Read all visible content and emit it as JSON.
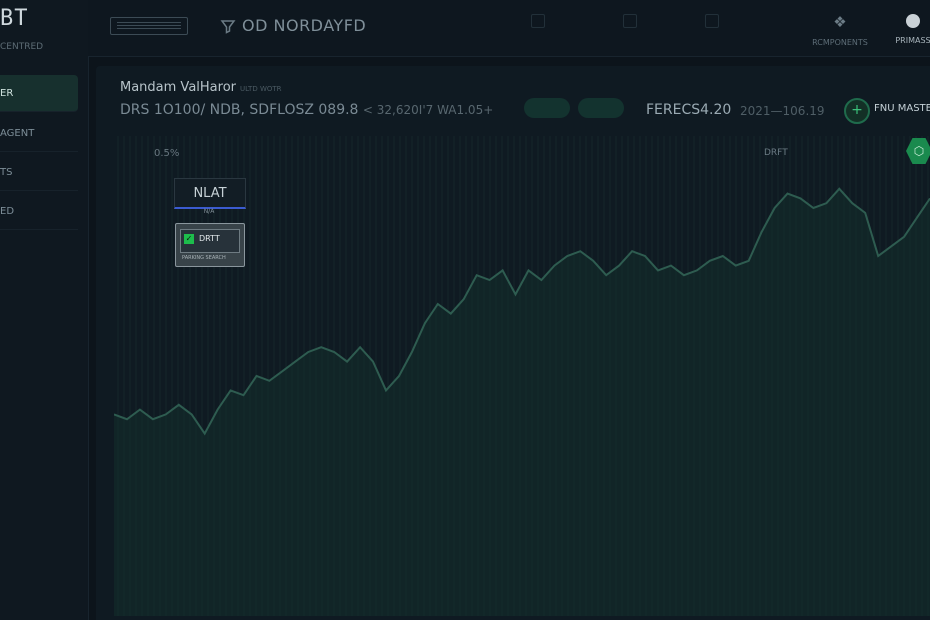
{
  "app": {
    "logo": "BT",
    "logo_sub": "CENTRED",
    "title": "OD NORDAYFD"
  },
  "icons": {
    "menu": "menu-icon",
    "filter": "filter-icon",
    "components": "network-icon",
    "avatar": "user-avatar-icon",
    "add": "plus-icon",
    "hex": "hexagon-icon",
    "check": "check-icon"
  },
  "colors": {
    "accent": "#1a8a4e",
    "chart_line": "#2e5c50",
    "selection": "#3b5bd1"
  },
  "sidebar": {
    "items": [
      {
        "label": "ER",
        "active": true
      },
      {
        "label": "AGENT",
        "active": false
      },
      {
        "label": "TS",
        "active": false
      },
      {
        "label": "ED",
        "active": false
      }
    ]
  },
  "topnav": {
    "components_label": "RCMPONENTS",
    "user_label": "PRIMASS"
  },
  "panel": {
    "title": "Mandam ValHaror",
    "subtitle": "ULTD WOTR",
    "stats_main": "DRS 1O100/ NDB, SDFLOSZ 089.8",
    "stats_tail": "< 32,620I'7 WA1.05+",
    "price": "FERECS4.20",
    "range": "2021—106.19",
    "action_label": "FNU MASTE"
  },
  "chart": {
    "pct_label": "0.5%",
    "drift_label": "DRFT"
  },
  "selector": {
    "label": "NLAT",
    "sub": "N/A",
    "card_label": "DRTT",
    "card_sub": "PARKING SEARCH"
  },
  "chart_data": {
    "type": "line",
    "series": [
      {
        "values": [
          0.42,
          0.41,
          0.43,
          0.41,
          0.42,
          0.44,
          0.42,
          0.38,
          0.43,
          0.47,
          0.46,
          0.5,
          0.49,
          0.51,
          0.53,
          0.55,
          0.56,
          0.55,
          0.53,
          0.56,
          0.53,
          0.47,
          0.5,
          0.55,
          0.61,
          0.65,
          0.63,
          0.66,
          0.71,
          0.7,
          0.72,
          0.67,
          0.72,
          0.7,
          0.73,
          0.75,
          0.76,
          0.74,
          0.71,
          0.73,
          0.76,
          0.75,
          0.72,
          0.73,
          0.71,
          0.72,
          0.74,
          0.75,
          0.73,
          0.74,
          0.8,
          0.85,
          0.88,
          0.87,
          0.85,
          0.86,
          0.89,
          0.86,
          0.84,
          0.75,
          0.77,
          0.79,
          0.83,
          0.87
        ]
      }
    ]
  }
}
